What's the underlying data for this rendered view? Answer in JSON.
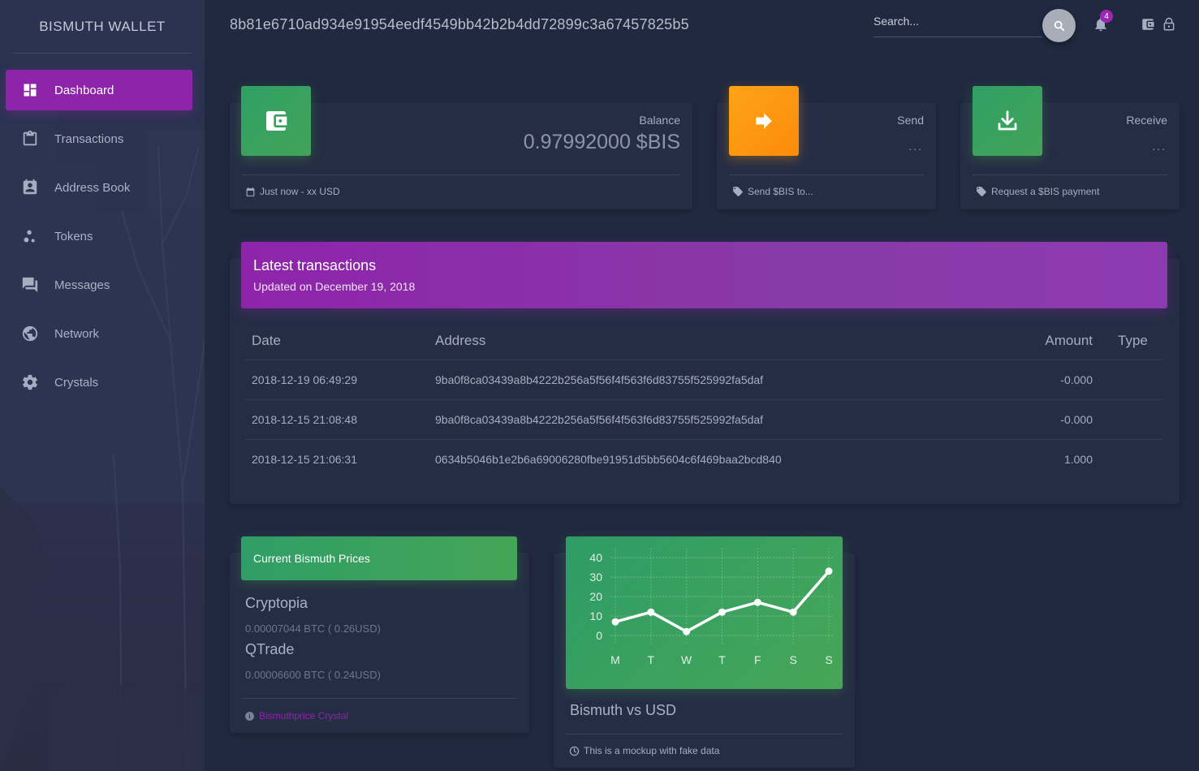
{
  "sidebar": {
    "brand": "BISMUTH WALLET",
    "items": [
      {
        "label": "Dashboard",
        "icon": "dashboard-icon"
      },
      {
        "label": "Transactions",
        "icon": "clipboard-icon"
      },
      {
        "label": "Address Book",
        "icon": "contacts-icon"
      },
      {
        "label": "Tokens",
        "icon": "bubbles-icon"
      },
      {
        "label": "Messages",
        "icon": "forum-icon"
      },
      {
        "label": "Network",
        "icon": "globe-icon"
      },
      {
        "label": "Crystals",
        "icon": "gear-icon"
      }
    ],
    "active": "Dashboard"
  },
  "header": {
    "wallet_address": "8b81e6710ad934e91954eedf4549bb42b2b4dd72899c3a67457825b5",
    "search_placeholder": "Search...",
    "notification_count": "4"
  },
  "stats": {
    "balance": {
      "category": "Balance",
      "title": "0.97992000 $BIS",
      "footer": "Just now - xx USD"
    },
    "send": {
      "category": "Send",
      "title": "...",
      "footer": "Send $BIS to..."
    },
    "receive": {
      "category": "Receive",
      "title": "...",
      "footer": "Request a $BIS payment"
    }
  },
  "transactions": {
    "title": "Latest transactions",
    "subtitle": "Updated on December 19, 2018",
    "columns": {
      "date": "Date",
      "address": "Address",
      "amount": "Amount",
      "type": "Type"
    },
    "rows": [
      {
        "date": "2018-12-19 06:49:29",
        "address": "9ba0f8ca03439a8b4222b256a5f56f4f563f6d83755f525992fa5daf",
        "amount": "-0.000",
        "type": ""
      },
      {
        "date": "2018-12-15 21:08:48",
        "address": "9ba0f8ca03439a8b4222b256a5f56f4f563f6d83755f525992fa5daf",
        "amount": "-0.000",
        "type": ""
      },
      {
        "date": "2018-12-15 21:06:31",
        "address": "0634b5046b1e2b6a69006280fbe91951d5bb5604c6f469baa2bcd840",
        "amount": "1.000",
        "type": ""
      }
    ]
  },
  "prices": {
    "title": "Current Bismuth Prices",
    "exchanges": [
      {
        "name": "Cryptopia",
        "value": "0.00007044 BTC ( 0.26USD)"
      },
      {
        "name": "QTrade",
        "value": "0.00006600 BTC ( 0.24USD)"
      }
    ],
    "link": "Bismuthprice Crystal"
  },
  "chart_card": {
    "title": "Bismuth vs USD",
    "footer": "This is a mockup with fake data"
  },
  "chart_data": {
    "type": "line",
    "categories": [
      "M",
      "T",
      "W",
      "T",
      "F",
      "S",
      "S"
    ],
    "values": [
      7,
      12,
      2,
      12,
      17,
      12,
      33
    ],
    "ylim": [
      0,
      40
    ],
    "yticks": [
      0,
      10,
      20,
      30,
      40
    ],
    "grid": true,
    "title": "",
    "xlabel": "",
    "ylabel": ""
  },
  "colors": {
    "background": "#202940",
    "card": "#252d45",
    "accent_purple": "#8e24aa",
    "success_green": "#43a047",
    "warning_orange": "#fb8c00",
    "negative_amount": "#ef6c00",
    "positive_amount": "#2e8b62"
  }
}
